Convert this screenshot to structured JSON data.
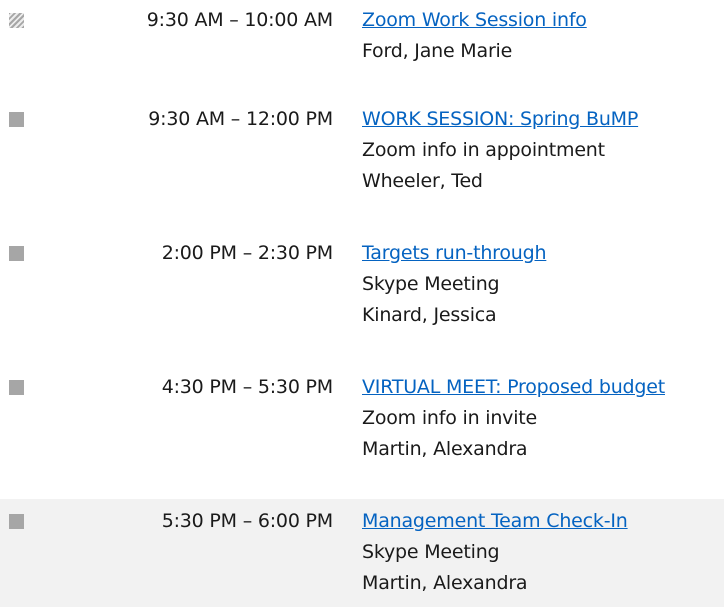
{
  "events": [
    {
      "status": "tentative",
      "time": "9:30 AM – 10:00 AM",
      "title": "Zoom Work Session info",
      "location": "",
      "organizer": "Ford, Jane Marie"
    },
    {
      "status": "busy",
      "time": "9:30 AM – 12:00 PM",
      "title": "WORK SESSION: Spring BuMP",
      "location": "Zoom info in appointment",
      "organizer": "Wheeler, Ted"
    },
    {
      "status": "busy",
      "time": "2:00 PM – 2:30 PM",
      "title": "Targets run-through",
      "location": "Skype Meeting",
      "organizer": "Kinard, Jessica"
    },
    {
      "status": "busy",
      "time": "4:30 PM – 5:30 PM",
      "title": "VIRTUAL MEET: Proposed budget",
      "location": "Zoom info in invite",
      "organizer": "Martin, Alexandra"
    },
    {
      "status": "busy",
      "time": "5:30 PM – 6:00 PM",
      "title": "Management Team Check-In",
      "location": "Skype Meeting",
      "organizer": "Martin, Alexandra"
    }
  ]
}
